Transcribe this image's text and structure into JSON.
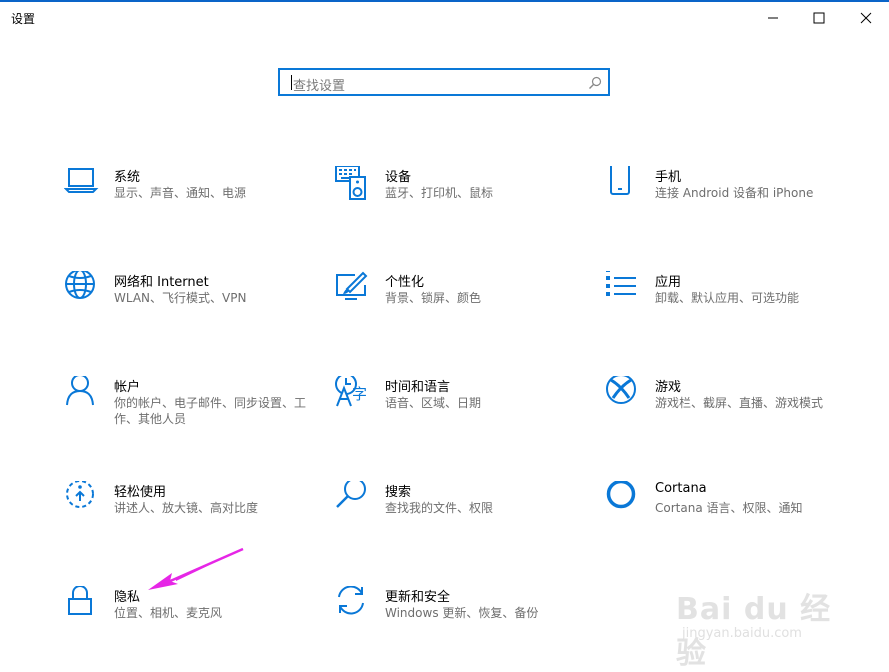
{
  "window": {
    "title": "设置",
    "controls": [
      {
        "name": "minimize-button",
        "icon": "minimize-icon"
      },
      {
        "name": "maximize-button",
        "icon": "maximize-icon"
      },
      {
        "name": "close-button",
        "icon": "close-icon"
      }
    ]
  },
  "search": {
    "placeholder": "查找设置",
    "icon": "search-icon"
  },
  "accent_color": "#0a78d7",
  "categories": [
    {
      "name": "系统",
      "desc": "显示、声音、通知、电源",
      "icon": "laptop-icon"
    },
    {
      "name": "设备",
      "desc": "蓝牙、打印机、鼠标",
      "icon": "keyboard-speaker-icon"
    },
    {
      "name": "手机",
      "desc": "连接 Android 设备和 iPhone",
      "icon": "phone-icon"
    },
    {
      "name": "网络和 Internet",
      "desc": "WLAN、飞行模式、VPN",
      "icon": "globe-icon"
    },
    {
      "name": "个性化",
      "desc": "背景、锁屏、颜色",
      "icon": "paintbrush-icon"
    },
    {
      "name": "应用",
      "desc": "卸载、默认应用、可选功能",
      "icon": "apps-list-icon"
    },
    {
      "name": "帐户",
      "desc": "你的帐户、电子邮件、同步设置、工作、其他人员",
      "icon": "person-icon"
    },
    {
      "name": "时间和语言",
      "desc": "语音、区域、日期",
      "icon": "time-language-icon"
    },
    {
      "name": "游戏",
      "desc": "游戏栏、截屏、直播、游戏模式",
      "icon": "xbox-icon"
    },
    {
      "name": "轻松使用",
      "desc": "讲述人、放大镜、高对比度",
      "icon": "ease-of-access-icon"
    },
    {
      "name": "搜索",
      "desc": "查找我的文件、权限",
      "icon": "search-icon"
    },
    {
      "name": "Cortana",
      "desc": "Cortana 语言、权限、通知",
      "icon": "cortana-icon"
    },
    {
      "name": "隐私",
      "desc": "位置、相机、麦克风",
      "icon": "lock-icon"
    },
    {
      "name": "更新和安全",
      "desc": "Windows 更新、恢复、备份",
      "icon": "sync-icon"
    }
  ],
  "annotation": {
    "arrow_color": "#e626e6"
  },
  "watermark": {
    "logo": "Bai du 经验",
    "url": "jingyan.baidu.com"
  }
}
